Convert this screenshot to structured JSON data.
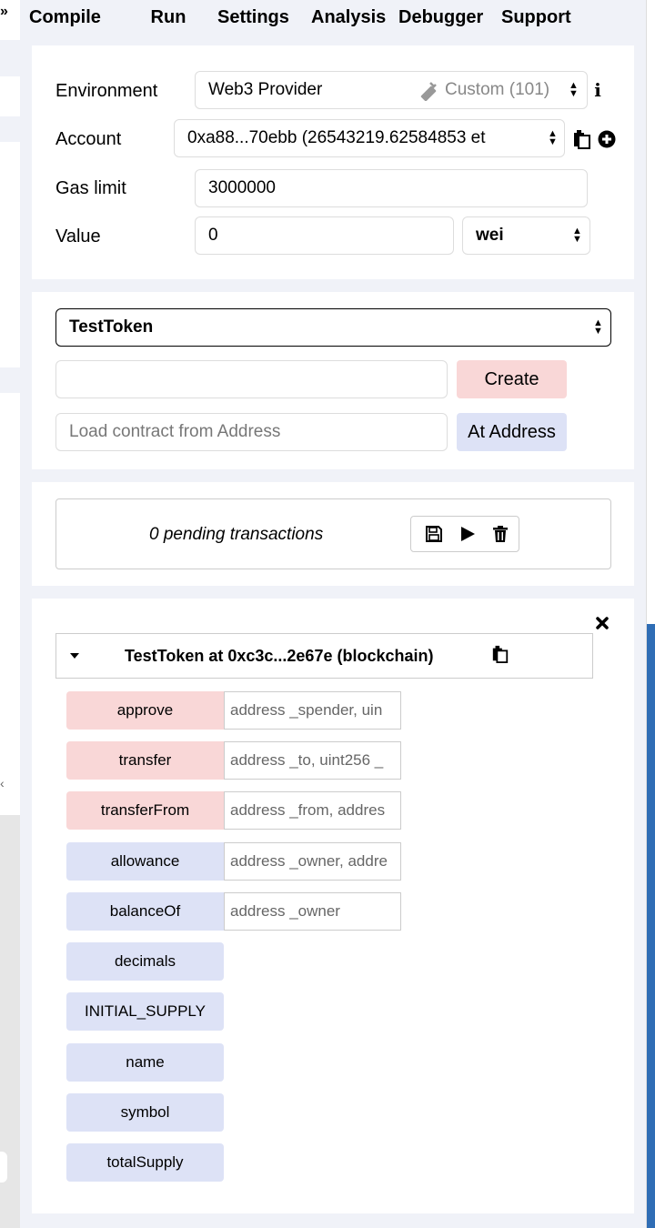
{
  "tabs": [
    {
      "label": "Compile"
    },
    {
      "label": "Run"
    },
    {
      "label": "Settings"
    },
    {
      "label": "Analysis"
    },
    {
      "label": "Debugger"
    },
    {
      "label": "Support"
    }
  ],
  "settings": {
    "environment_label": "Environment",
    "environment_value": "Web3 Provider",
    "environment_network": "Custom (101)",
    "account_label": "Account",
    "account_value": "0xa88...70ebb (26543219.62584853 et",
    "gas_label": "Gas limit",
    "gas_value": "3000000",
    "value_label": "Value",
    "value_value": "0",
    "value_unit": "wei"
  },
  "contract": {
    "selected": "TestToken",
    "create_label": "Create",
    "address_placeholder": "Load contract from Address",
    "at_address_label": "At Address"
  },
  "transactions": {
    "pending_text": "0 pending transactions"
  },
  "instance": {
    "title": "TestToken at 0xc3c...2e67e (blockchain)",
    "functions": [
      {
        "name": "approve",
        "params": "address _spender, uin",
        "kind": "transact"
      },
      {
        "name": "transfer",
        "params": "address _to, uint256 _",
        "kind": "transact"
      },
      {
        "name": "transferFrom",
        "params": "address _from, addres",
        "kind": "transact"
      },
      {
        "name": "allowance",
        "params": "address _owner, addre",
        "kind": "call"
      },
      {
        "name": "balanceOf",
        "params": "address _owner",
        "kind": "call"
      },
      {
        "name": "decimals",
        "params": "",
        "kind": "call"
      },
      {
        "name": "INITIAL_SUPPLY",
        "params": "",
        "kind": "call"
      },
      {
        "name": "name",
        "params": "",
        "kind": "call"
      },
      {
        "name": "symbol",
        "params": "",
        "kind": "call"
      },
      {
        "name": "totalSupply",
        "params": "",
        "kind": "call"
      }
    ]
  },
  "colors": {
    "transact": "#f9d7d7",
    "call": "#dde2f6",
    "panel_bg": "#f0f2f8"
  },
  "icons": [
    "plug-icon",
    "info-icon",
    "copy-icon",
    "plus-circle-icon",
    "save-icon",
    "play-icon",
    "trash-icon",
    "close-icon",
    "caret-down-icon"
  ]
}
